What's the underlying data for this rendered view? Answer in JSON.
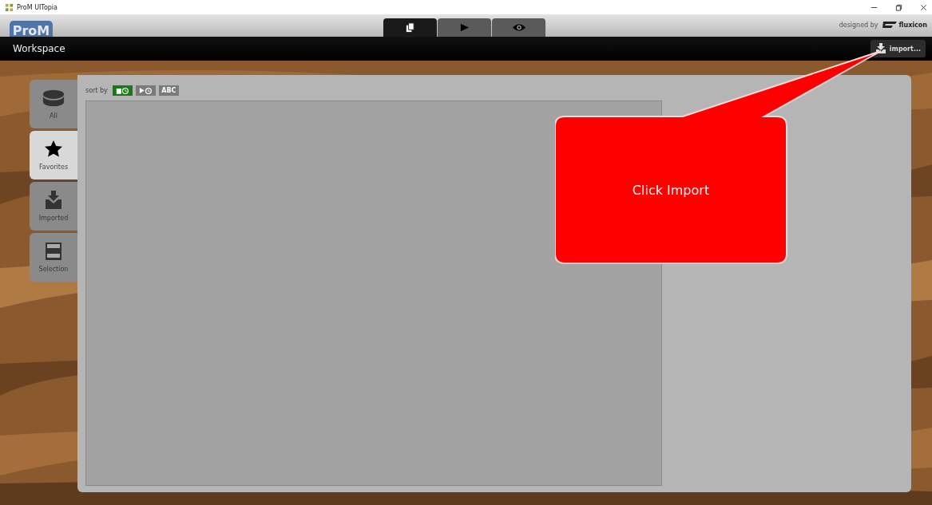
{
  "window": {
    "title": "ProM UITopia"
  },
  "header": {
    "logo": "ProM",
    "credit": "designed by",
    "brand": "fluxicon",
    "tabs": [
      {
        "kind": "workspace",
        "selected": true
      },
      {
        "kind": "action",
        "selected": false
      },
      {
        "kind": "view",
        "selected": false
      }
    ]
  },
  "toolbar": {
    "title": "Workspace",
    "import_button": "import..."
  },
  "sidebar": {
    "items": [
      {
        "label": "All",
        "kind": "all",
        "selected": false
      },
      {
        "label": "Favorites",
        "kind": "favorites",
        "selected": true
      },
      {
        "label": "Imported",
        "kind": "imported",
        "selected": false
      },
      {
        "label": "Selection",
        "kind": "selection",
        "selected": false
      }
    ]
  },
  "sort": {
    "label": "sort by",
    "options": [
      {
        "kind": "creation",
        "selected": true
      },
      {
        "kind": "access",
        "selected": false
      },
      {
        "kind": "name",
        "label": "ABC",
        "selected": false
      }
    ]
  },
  "callout": {
    "text": "Click Import"
  }
}
